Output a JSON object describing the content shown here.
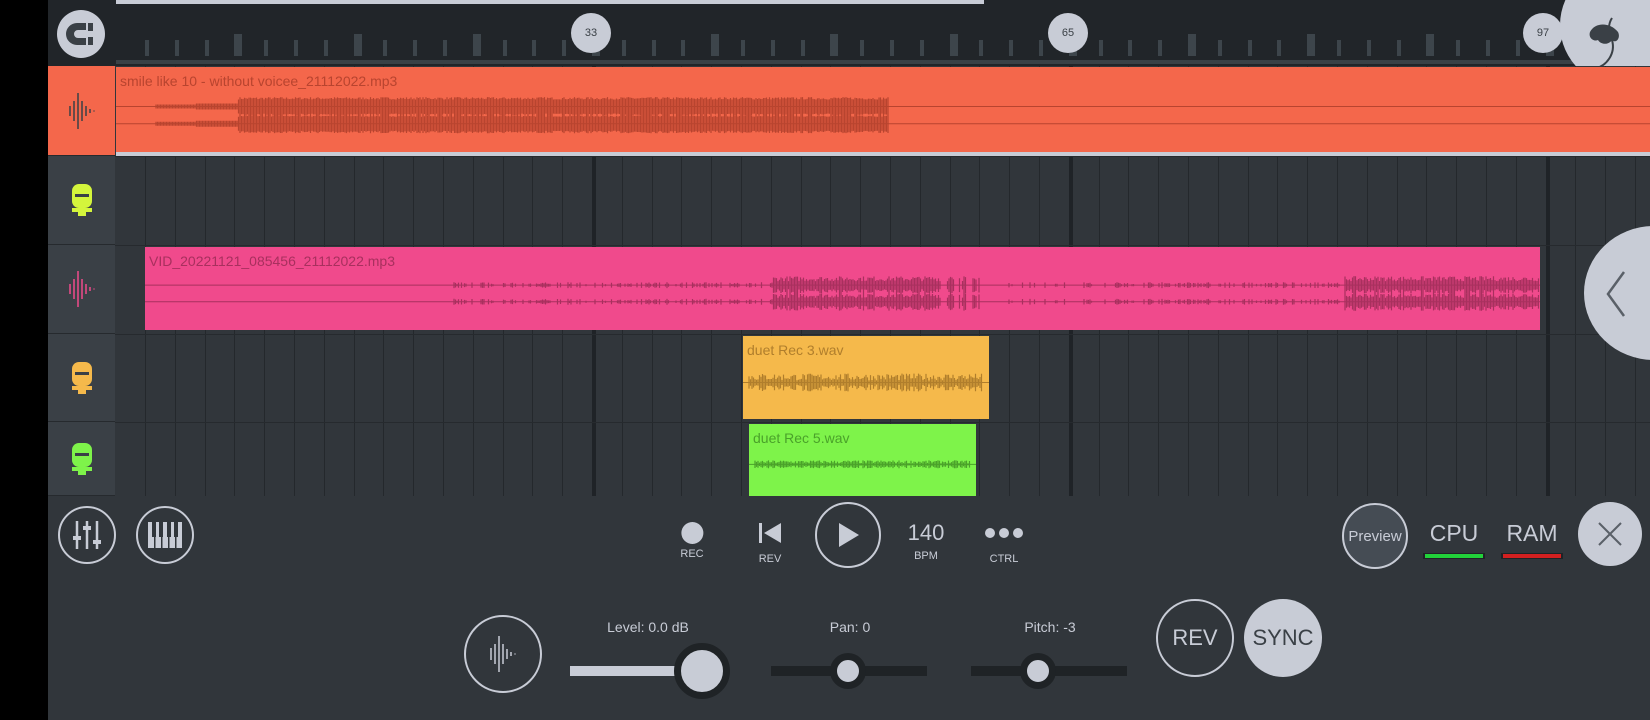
{
  "ruler": {
    "markers": [
      "33",
      "65",
      "97"
    ]
  },
  "tracks": [
    {
      "icon": "waveform-icon",
      "color": "#f4674b"
    },
    {
      "icon": "microphone-icon",
      "color": "#d4f53c"
    },
    {
      "icon": "waveform-icon",
      "color": "#f04a8c"
    },
    {
      "icon": "microphone-icon",
      "color": "#f5b94b"
    },
    {
      "icon": "microphone-icon",
      "color": "#7ef34a"
    }
  ],
  "clips": [
    {
      "name": "smile like 10 - without voicee_21112022.mp3",
      "color": "#f4674b",
      "wave": "#b8442f"
    },
    {
      "name": "VID_20221121_085456_21112022.mp3",
      "color": "#f04a8c",
      "wave": "#a8305e"
    },
    {
      "name": "duet Rec 3.wav",
      "color": "#f5b94b",
      "wave": "#b07e2c"
    },
    {
      "name": "duet Rec 5.wav",
      "color": "#7ef34a",
      "wave": "#4aa22a"
    }
  ],
  "toolbar": {
    "rec": "REC",
    "rev": "REV",
    "bpm_value": "140",
    "bpm": "BPM",
    "ctrl": "CTRL",
    "preview": "Preview",
    "cpu": "CPU",
    "ram": "RAM",
    "cpu_color": "#22d23a",
    "ram_color": "#d32020"
  },
  "bottom": {
    "level": "Level: 0.0 dB",
    "pan": "Pan: 0",
    "pitch": "Pitch: -3",
    "rev": "REV",
    "sync": "SYNC",
    "level_value": 1.0,
    "pan_value": 0,
    "pitch_value": -3
  }
}
